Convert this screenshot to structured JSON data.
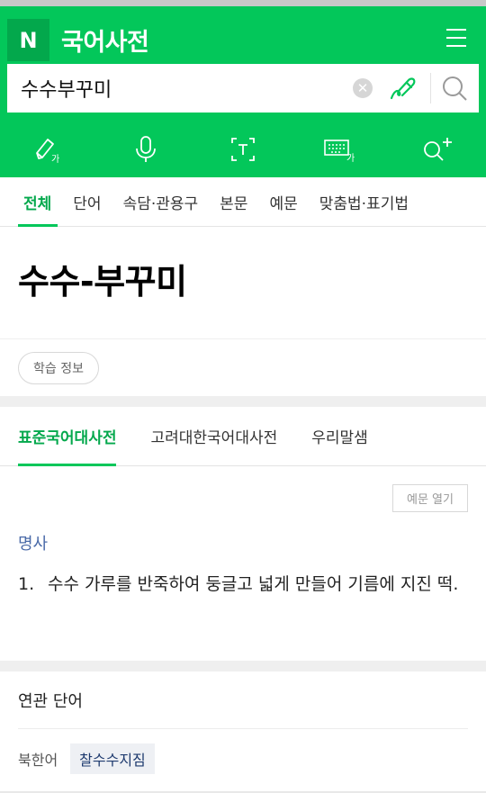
{
  "header": {
    "logo": "N",
    "title": "국어사전"
  },
  "search": {
    "query": "수수부꾸미",
    "placeholder": ""
  },
  "tabs": [
    {
      "label": "전체",
      "active": true
    },
    {
      "label": "단어"
    },
    {
      "label": "속담·관용구"
    },
    {
      "label": "본문"
    },
    {
      "label": "예문"
    },
    {
      "label": "맞춤법·표기법"
    }
  ],
  "entry": {
    "word": "수수-부꾸미",
    "study_label": "학습 정보"
  },
  "dict_tabs": [
    {
      "label": "표준국어대사전",
      "active": true
    },
    {
      "label": "고려대한국어대사전"
    },
    {
      "label": "우리말샘"
    }
  ],
  "definition": {
    "example_toggle": "예문 열기",
    "part_of_speech": "명사",
    "senses": [
      {
        "num": "1.",
        "text": "수수 가루를 반죽하여 둥글고 넓게 만들어 기름에 지진 떡."
      }
    ]
  },
  "related": {
    "title": "연관 단어",
    "rows": [
      {
        "label": "북한어",
        "words": [
          "찰수수지짐"
        ]
      }
    ]
  },
  "colors": {
    "brand": "#03c75a",
    "brand_dark": "#03a84c",
    "pos_blue": "#4a6aa8"
  },
  "icons": [
    "hamburger-menu-icon",
    "clear-icon",
    "handwriting-pen-icon",
    "search-icon",
    "handwriting-icon",
    "microphone-icon",
    "text-recognition-icon",
    "keyboard-icon",
    "search-plus-icon"
  ]
}
